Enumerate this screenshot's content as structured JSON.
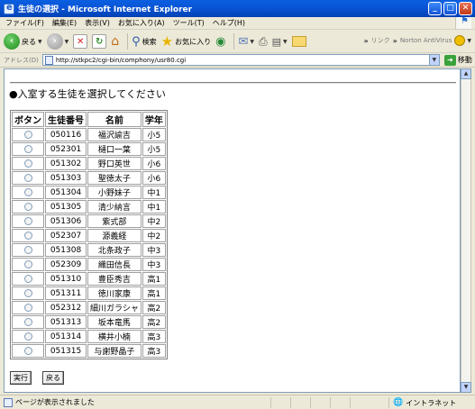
{
  "window": {
    "title": "生徒の選択 - Microsoft Internet Explorer"
  },
  "menu": [
    "ファイル(F)",
    "編集(E)",
    "表示(V)",
    "お気に入り(A)",
    "ツール(T)",
    "ヘルプ(H)"
  ],
  "toolbar": {
    "back": "戻る",
    "search": "検索",
    "favorites": "お気に入り",
    "links": "リンク",
    "norton": "Norton AntiVirus"
  },
  "address": {
    "label": "アドレス(D)",
    "url": "http://stkpc2/cgi-bin/comphony/usr80.cgi",
    "go": "移動"
  },
  "page": {
    "heading": "●入室する生徒を選択してください",
    "columns": [
      "ボタン",
      "生徒番号",
      "名前",
      "学年"
    ],
    "rows": [
      {
        "id": "050116",
        "name": "福沢諭吉",
        "grade": "小5"
      },
      {
        "id": "052301",
        "name": "樋口一葉",
        "grade": "小5"
      },
      {
        "id": "051302",
        "name": "野口英世",
        "grade": "小6"
      },
      {
        "id": "051303",
        "name": "聖徳太子",
        "grade": "小6"
      },
      {
        "id": "051304",
        "name": "小野妹子",
        "grade": "中1"
      },
      {
        "id": "051305",
        "name": "清少納言",
        "grade": "中1"
      },
      {
        "id": "051306",
        "name": "紫式部",
        "grade": "中2"
      },
      {
        "id": "052307",
        "name": "源義経",
        "grade": "中2"
      },
      {
        "id": "051308",
        "name": "北条政子",
        "grade": "中3"
      },
      {
        "id": "052309",
        "name": "織田信長",
        "grade": "中3"
      },
      {
        "id": "051310",
        "name": "豊臣秀吉",
        "grade": "高1"
      },
      {
        "id": "051311",
        "name": "徳川家康",
        "grade": "高1"
      },
      {
        "id": "052312",
        "name": "細川ガラシャ",
        "grade": "高2"
      },
      {
        "id": "051313",
        "name": "坂本竜馬",
        "grade": "高2"
      },
      {
        "id": "051314",
        "name": "横井小楠",
        "grade": "高3"
      },
      {
        "id": "051315",
        "name": "与謝野晶子",
        "grade": "高3"
      }
    ],
    "execute_label": "実行",
    "back_label": "戻る"
  },
  "status": {
    "text": "ページが表示されました",
    "zone": "イントラネット"
  }
}
